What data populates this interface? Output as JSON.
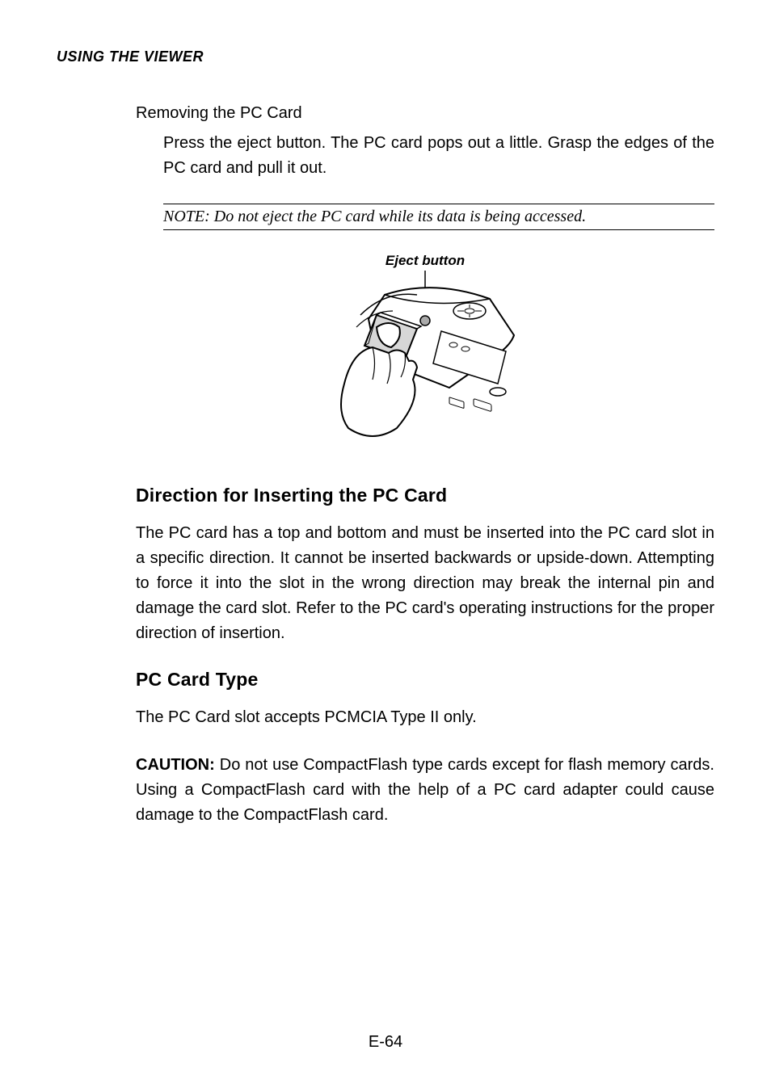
{
  "runningHead": "USING THE VIEWER",
  "section1": {
    "title": "Removing the PC Card",
    "body": "Press the eject button. The PC card pops out a little. Grasp the edges of the PC card and pull it out."
  },
  "note": "NOTE: Do not eject the PC card while its data is being accessed.",
  "figure": {
    "caption": "Eject button"
  },
  "section2": {
    "heading": "Direction for Inserting the PC Card",
    "body": "The PC card has a top and bottom and must be inserted into the PC card slot in a specific direction. It cannot be inserted backwards or upside-down. Attempting to force it into the slot in the wrong direction may break the internal pin and damage the card slot. Refer to the PC card's operating instructions for the proper direction of insertion."
  },
  "section3": {
    "heading": "PC Card Type",
    "body": "The PC Card slot accepts PCMCIA Type II only."
  },
  "caution": {
    "label": "CAUTION:",
    "body": " Do not use CompactFlash type cards except for flash memory cards. Using a CompactFlash card with the help of a PC card adapter could cause damage to the CompactFlash card."
  },
  "pageNumber": "E-64"
}
